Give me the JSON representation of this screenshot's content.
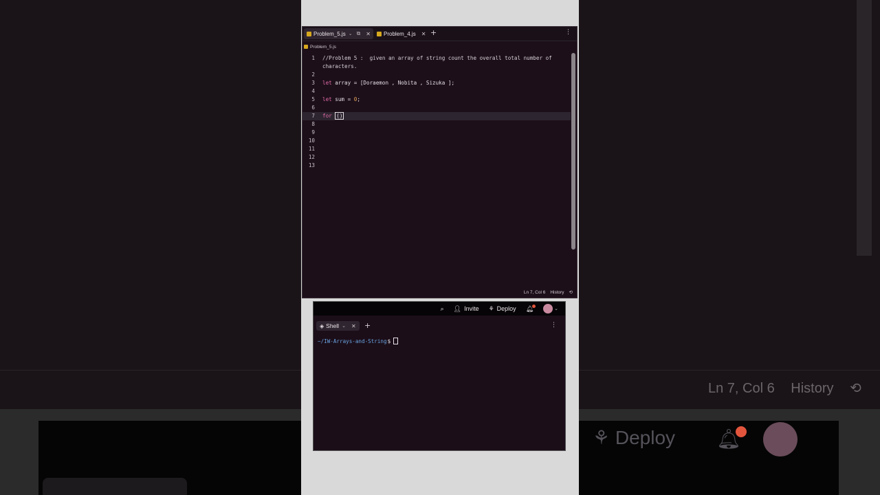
{
  "background": {
    "status": [
      "Ln 7, Col 6",
      "History"
    ],
    "deploy": "Deploy"
  },
  "editor": {
    "tabs": [
      {
        "label": "Problem_5.js"
      },
      {
        "label": "Problem_4.js"
      }
    ],
    "breadcrumb": "Problem_5.js",
    "lines": [
      {
        "n": "1",
        "text": "//Problem 5 :  given an array of string count the overall total number of"
      },
      {
        "n": "",
        "text": "characters."
      },
      {
        "n": "2",
        "text": ""
      },
      {
        "n": "3",
        "text": "let array = [Doraemon , Nobita , Sizuka ];"
      },
      {
        "n": "4",
        "text": ""
      },
      {
        "n": "5",
        "text": "let sum = 0;"
      },
      {
        "n": "6",
        "text": ""
      },
      {
        "n": "7",
        "text": "for ()"
      },
      {
        "n": "8",
        "text": ""
      },
      {
        "n": "9",
        "text": ""
      },
      {
        "n": "10",
        "text": ""
      },
      {
        "n": "11",
        "text": ""
      },
      {
        "n": "12",
        "text": ""
      },
      {
        "n": "13",
        "text": ""
      }
    ],
    "status": {
      "position": "Ln 7, Col 6",
      "history": "History"
    }
  },
  "terminal": {
    "topbar": {
      "invite": "Invite",
      "deploy": "Deploy"
    },
    "tab": "Shell",
    "cwd": "~/IW-Arrays-and-String",
    "prompt_symbol": "$"
  },
  "colors": {
    "editor_bg": "#1c0f1a",
    "keyword": "#e26aa6",
    "number": "#e7a55a",
    "path": "#6aa3e0",
    "js_icon": "#d6a81e"
  }
}
